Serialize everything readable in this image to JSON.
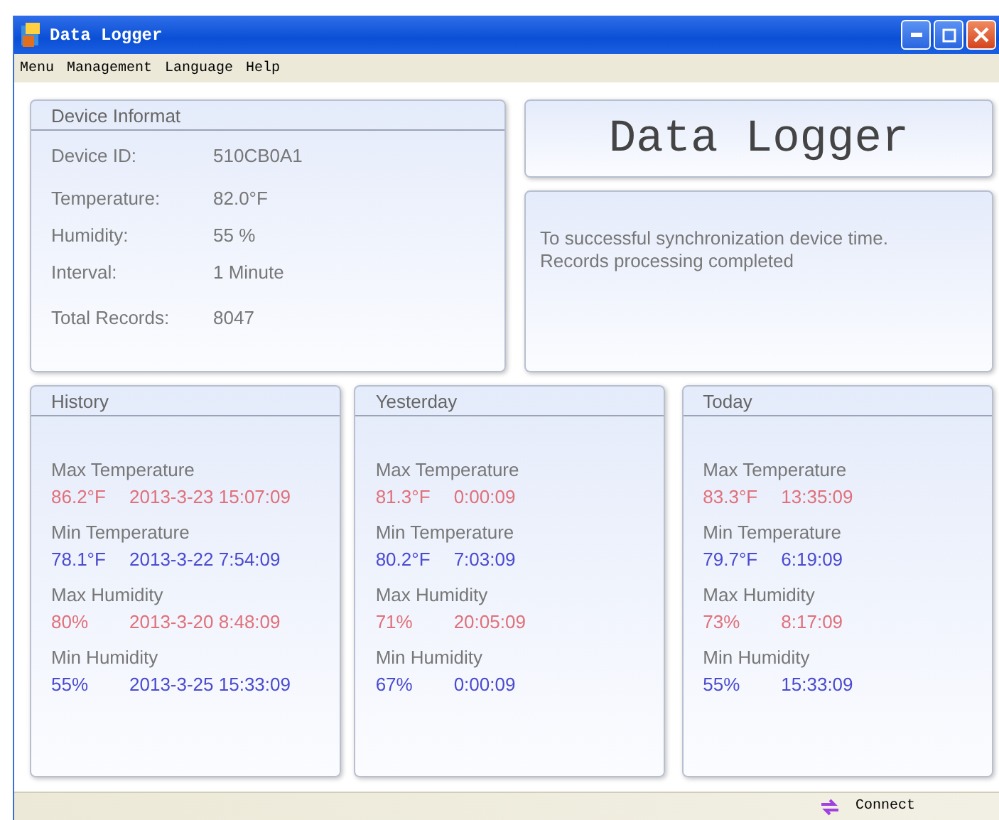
{
  "window": {
    "title": "Data Logger"
  },
  "menu": [
    "Menu",
    "Management",
    "Language",
    "Help"
  ],
  "device_info": {
    "title": "Device Informat",
    "fields": [
      {
        "label": "Device ID:",
        "value": "510CB0A1"
      },
      {
        "label": "Temperature:",
        "value": "82.0°F"
      },
      {
        "label": "Humidity:",
        "value": "55 %"
      },
      {
        "label": "Interval:",
        "value": "1 Minute"
      },
      {
        "label": "Total Records:",
        "value": "8047"
      }
    ]
  },
  "logo": "Data Logger",
  "messages": [
    "To successful synchronization device time.",
    "Records processing completed"
  ],
  "panels": [
    {
      "title": "History",
      "stats": [
        {
          "label": "Max Temperature",
          "kind": "max",
          "value": "86.2°F",
          "time": "2013-3-23 15:07:09"
        },
        {
          "label": "Min Temperature",
          "kind": "min",
          "value": "78.1°F",
          "time": "2013-3-22 7:54:09"
        },
        {
          "label": "Max Humidity",
          "kind": "max",
          "value": "80%",
          "time": "2013-3-20 8:48:09"
        },
        {
          "label": "Min Humidity",
          "kind": "min",
          "value": "55%",
          "time": "2013-3-25 15:33:09"
        }
      ]
    },
    {
      "title": "Yesterday",
      "stats": [
        {
          "label": "Max Temperature",
          "kind": "max",
          "value": "81.3°F",
          "time": "0:00:09"
        },
        {
          "label": "Min Temperature",
          "kind": "min",
          "value": "80.2°F",
          "time": "7:03:09"
        },
        {
          "label": "Max Humidity",
          "kind": "max",
          "value": "71%",
          "time": "20:05:09"
        },
        {
          "label": "Min Humidity",
          "kind": "min",
          "value": "67%",
          "time": "0:00:09"
        }
      ]
    },
    {
      "title": "Today",
      "stats": [
        {
          "label": "Max Temperature",
          "kind": "max",
          "value": "83.3°F",
          "time": "13:35:09"
        },
        {
          "label": "Min Temperature",
          "kind": "min",
          "value": "79.7°F",
          "time": "6:19:09"
        },
        {
          "label": "Max Humidity",
          "kind": "max",
          "value": "73%",
          "time": "8:17:09"
        },
        {
          "label": "Min Humidity",
          "kind": "min",
          "value": "55%",
          "time": "15:33:09"
        }
      ]
    }
  ],
  "status_bar": {
    "text": "Connect"
  }
}
